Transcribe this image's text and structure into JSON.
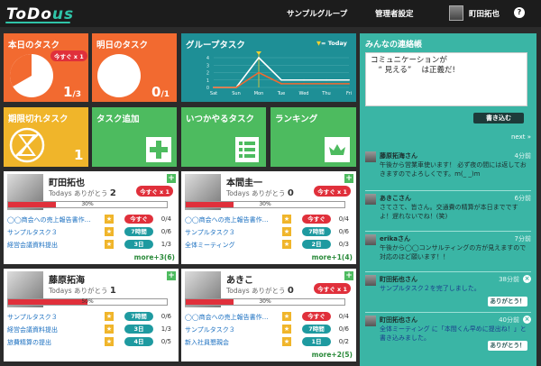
{
  "header": {
    "logo_main": "ToDo",
    "logo_accent": "us",
    "nav_group": "サンプルグループ",
    "nav_admin": "管理者設定",
    "user_name": "町田拓也",
    "help": "?"
  },
  "tiles": {
    "today": {
      "title": "本日のタスク",
      "badge": "今すぐ x 1",
      "count": "1",
      "total": "/3"
    },
    "tomorrow": {
      "title": "明日のタスク",
      "count": "0",
      "total": "/1"
    },
    "group": {
      "title": "グループタスク",
      "legend": "= Today",
      "days": [
        "Sat",
        "Sun",
        "Mon",
        "Tue",
        "Wed",
        "Thu",
        "Fri"
      ],
      "y_ticks": [
        "4",
        "3",
        "2",
        "1",
        "0"
      ]
    },
    "overdue": {
      "title": "期限切れタスク",
      "count": "1"
    },
    "add": {
      "title": "タスク追加"
    },
    "someday": {
      "title": "いつかやるタスク"
    },
    "ranking": {
      "title": "ランキング"
    }
  },
  "chart_data": {
    "type": "line",
    "categories": [
      "Sat",
      "Sun",
      "Mon",
      "Tue",
      "Wed",
      "Thu",
      "Fri"
    ],
    "ylim": [
      0,
      4
    ],
    "series": [
      {
        "values": [
          0,
          0,
          4,
          1,
          1,
          1,
          1
        ],
        "color": "#ffffff"
      },
      {
        "values": [
          0,
          0,
          2,
          0.5,
          0.5,
          0.5,
          0.5
        ],
        "color": "#f26a30"
      }
    ],
    "today_index": 2,
    "legend": "= Today"
  },
  "members": [
    {
      "name": "町田拓也",
      "thanks_label": "Todays ありがとう",
      "thanks": "2",
      "badge": "今すぐ x 1",
      "progress": 30,
      "progress_label": "30%",
      "tasks": [
        {
          "name": "◯◯商会への売上報告書作…",
          "due": "今すぐ",
          "due_color": "red",
          "frac": "0/4"
        },
        {
          "name": "サンプルタスク３",
          "due": "7時間",
          "due_color": "teal",
          "frac": "0/6"
        },
        {
          "name": "経営会議資料提出",
          "due": "3日",
          "due_color": "teal",
          "frac": "1/3"
        }
      ],
      "more": "more+3(6)"
    },
    {
      "name": "本間圭一",
      "thanks_label": "Todays ありがとう",
      "thanks": "0",
      "badge": "今すぐ x 1",
      "progress": 30,
      "progress_label": "30%",
      "tasks": [
        {
          "name": "◯◯商会への売上報告書作…",
          "due": "今すぐ",
          "due_color": "red",
          "frac": "0/4"
        },
        {
          "name": "サンプルタスク３",
          "due": "7時間",
          "due_color": "teal",
          "frac": "0/6"
        },
        {
          "name": "全体ミーティング",
          "due": "2日",
          "due_color": "teal",
          "frac": "0/3"
        }
      ],
      "more": "more+1(4)"
    },
    {
      "name": "藤原拓海",
      "thanks_label": "Todays ありがとう",
      "thanks": "1",
      "badge": "",
      "progress": 50,
      "progress_label": "50%",
      "tasks": [
        {
          "name": "サンプルタスク３",
          "due": "7時間",
          "due_color": "teal",
          "frac": "0/6"
        },
        {
          "name": "経営会議資料提出",
          "due": "3日",
          "due_color": "teal",
          "frac": "1/3"
        },
        {
          "name": "旅費精算の提出",
          "due": "4日",
          "due_color": "teal",
          "frac": "0/5"
        }
      ],
      "more": ""
    },
    {
      "name": "あきこ",
      "thanks_label": "Todays ありがとう",
      "thanks": "0",
      "badge": "今すぐ x 1",
      "progress": 30,
      "progress_label": "30%",
      "tasks": [
        {
          "name": "◯◯商会への売上報告書作…",
          "due": "今すぐ",
          "due_color": "red",
          "frac": "0/4"
        },
        {
          "name": "サンプルタスク３",
          "due": "7時間",
          "due_color": "teal",
          "frac": "0/6"
        },
        {
          "name": "新入社員懇親会",
          "due": "1日",
          "due_color": "teal",
          "frac": "0/2"
        }
      ],
      "more": "more+2(5)"
    }
  ],
  "sidebar": {
    "title": "みんなの連絡帳",
    "textarea": "コミュニケーションが\n　“ 見える” 　は正義だ!",
    "post_button": "書き込む",
    "next": "next »",
    "feed": [
      {
        "name": "藤原拓海さん",
        "time": "4分前",
        "body": "午後から営業車使います！ 必ず夜の間には返しておきますのでよろしくです。m(_ _)m"
      },
      {
        "name": "あきこさん",
        "time": "6分前",
        "body": "さてさて、皆さん。交通費の精算が本日までですよ！遅れないでね！(笑)"
      },
      {
        "name": "erikaさん",
        "time": "7分前",
        "body": "午後から◯◯コンサルティングの方が見えますので対応のほど願います！！"
      },
      {
        "name": "町田拓也さん",
        "time": "38分前",
        "body": "サンプルタスク２を完了しました。",
        "thanks": "ありがとう！"
      },
      {
        "name": "町田拓也さん",
        "time": "40分前",
        "body": "全体ミーティング に「本間くん早めに提出ね！」と書き込みました。",
        "thanks": "ありがとう！"
      }
    ]
  }
}
